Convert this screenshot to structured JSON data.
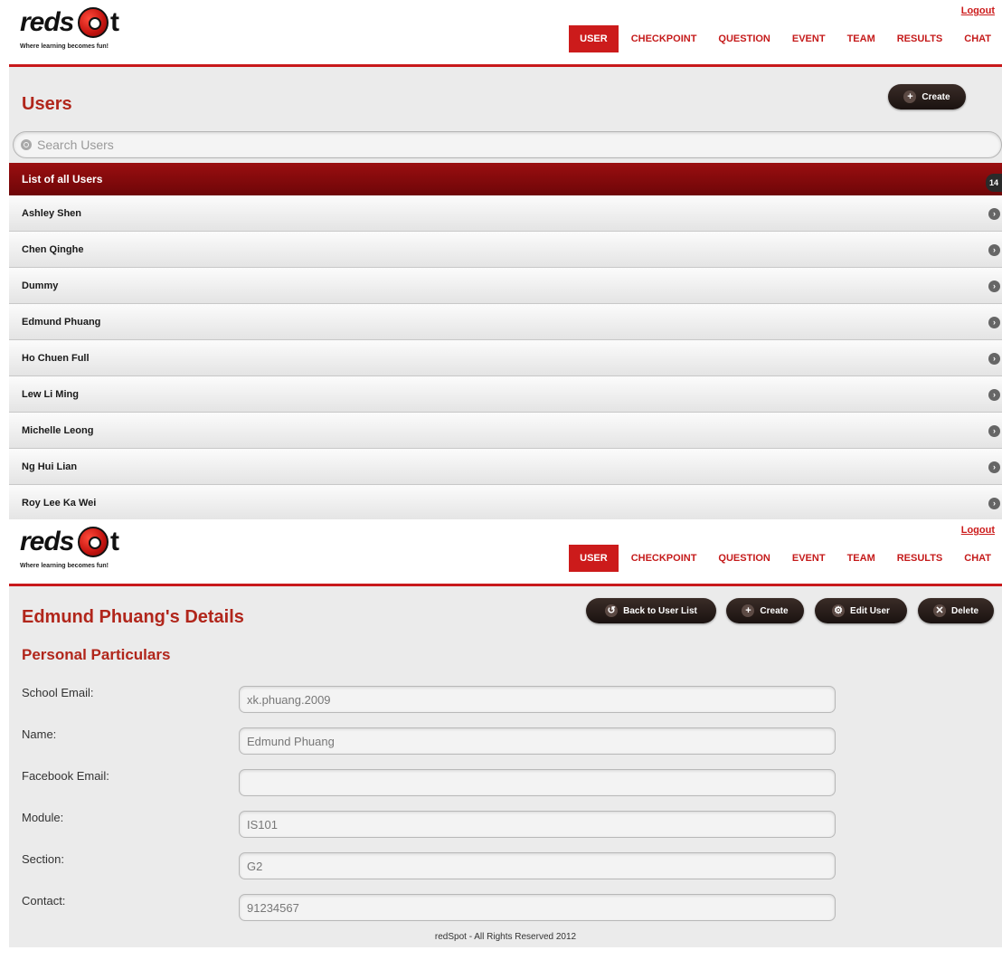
{
  "brand": {
    "logo_text": "redspot",
    "tagline": "Where learning becomes fun!"
  },
  "header": {
    "logout_label": "Logout",
    "nav": [
      "USER",
      "CHECKPOINT",
      "QUESTION",
      "EVENT",
      "TEAM",
      "RESULTS",
      "CHAT"
    ],
    "active_nav": "USER"
  },
  "users_page": {
    "title": "Users",
    "create_label": "Create",
    "search_placeholder": "Search Users",
    "list_header": "List of all Users",
    "count": "14",
    "users": [
      "Ashley Shen",
      "Chen Qinghe",
      "Dummy",
      "Edmund Phuang",
      "Ho Chuen Full",
      "Lew Li Ming",
      "Michelle Leong",
      "Ng Hui Lian",
      "Roy Lee Ka Wei"
    ]
  },
  "details_page": {
    "title": "Edmund Phuang's Details",
    "section_title": "Personal Particulars",
    "buttons": {
      "back": "Back to User List",
      "create": "Create",
      "edit": "Edit User",
      "delete": "Delete"
    },
    "fields": [
      {
        "label": "School Email:",
        "value": "xk.phuang.2009"
      },
      {
        "label": "Name:",
        "value": "Edmund Phuang"
      },
      {
        "label": "Facebook Email:",
        "value": ""
      },
      {
        "label": "Module:",
        "value": "IS101"
      },
      {
        "label": "Section:",
        "value": "G2"
      },
      {
        "label": "Contact:",
        "value": "91234567"
      }
    ],
    "footer": "redSpot - All Rights Reserved 2012"
  },
  "colors": {
    "accent": "#cc1b1b",
    "title_red": "#b1261b",
    "list_header": "#8a0b0d"
  }
}
